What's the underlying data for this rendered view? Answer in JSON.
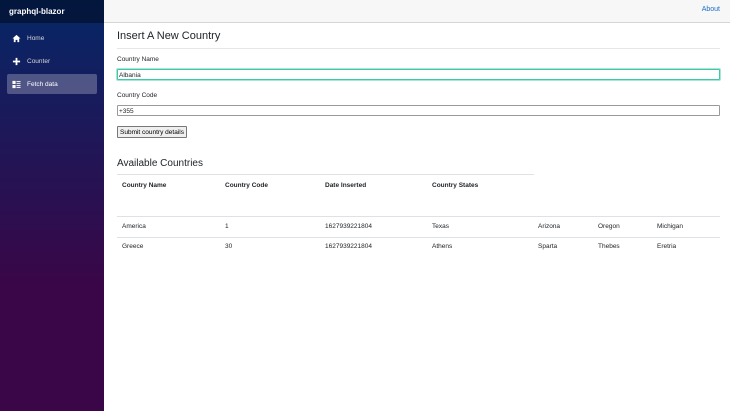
{
  "app": {
    "brand": "graphql-blazor"
  },
  "sidebar": {
    "items": [
      {
        "label": "Home",
        "icon": "home-icon"
      },
      {
        "label": "Counter",
        "icon": "plus-icon"
      },
      {
        "label": "Fetch data",
        "icon": "list-icon",
        "active": true
      }
    ]
  },
  "topbar": {
    "about": "About"
  },
  "form": {
    "title": "Insert A New Country",
    "name_label": "Country Name",
    "name_value": "Albania",
    "code_label": "Country Code",
    "code_value": "+355",
    "submit_label": "Submit country details"
  },
  "countries": {
    "title": "Available Countries",
    "headers": [
      "Country Name",
      "Country Code",
      "Date Inserted",
      "Country States"
    ],
    "rows": [
      {
        "name": "America",
        "code": "1",
        "date": "1627939221804",
        "states": [
          "Texas",
          "Arizona",
          "Oregon",
          "Michigan"
        ]
      },
      {
        "name": "Greece",
        "code": "30",
        "date": "1627939221804",
        "states": [
          "Athens",
          "Sparta",
          "Thebes",
          "Eretria"
        ]
      }
    ]
  },
  "colors": {
    "sidebar_top": "#052767",
    "sidebar_bottom": "#3a0647",
    "link": "#1b6ec2",
    "focus": "#3ec8a6"
  }
}
